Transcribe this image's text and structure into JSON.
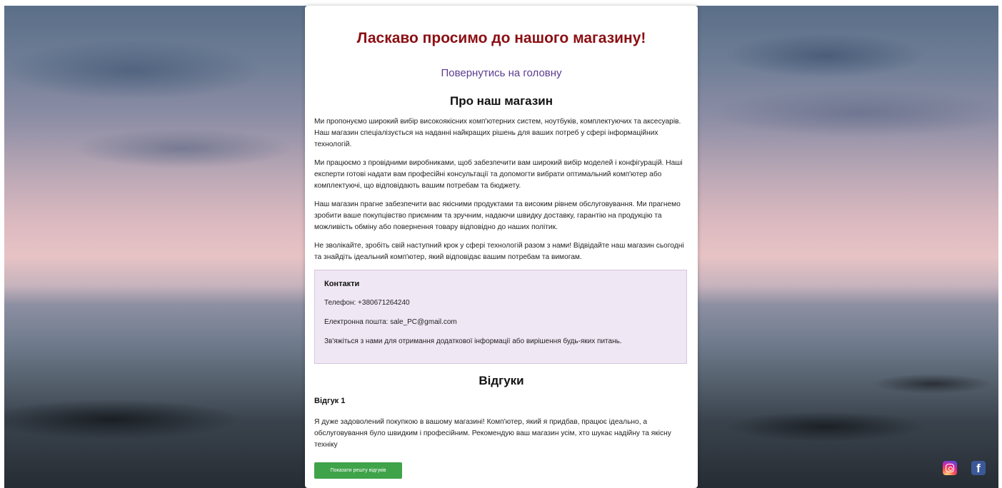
{
  "header": {
    "title": "Ласкаво просимо до нашого магазину!",
    "home_link": "Повернутись на головну"
  },
  "about": {
    "title": "Про наш магазин",
    "paragraphs": [
      "Ми пропонуємо широкий вибір високоякісних комп'ютерних систем, ноутбуків, комплектуючих та аксесуарів. Наш магазин спеціалізується на наданні найкращих рішень для ваших потреб у сфері інформаційних технологій.",
      "Ми працюємо з провідними виробниками, щоб забезпечити вам широкий вибір моделей і конфігурацій. Наші експерти готові надати вам професійні консультації та допомогти вибрати оптимальний комп'ютер або комплектуючі, що відповідають вашим потребам та бюджету.",
      "Наш магазин прагне забезпечити вас якісними продуктами та високим рівнем обслуговування. Ми прагнемо зробити ваше покупцівство приємним та зручним, надаючи швидку доставку, гарантію на продукцію та можливість обміну або повернення товару відповідно до наших політик.",
      "Не зволікайте, зробіть свій наступний крок у сфері технологій разом з нами! Відвідайте наш магазин сьогодні та знайдіть ідеальний комп'ютер, який відповідає вашим потребам та вимогам."
    ]
  },
  "contacts": {
    "title": "Контакти",
    "phone": "Телефон: +380671264240",
    "email": "Електронна пошта: sale_PC@gmail.com",
    "note": "Зв'яжіться з нами для отримання додаткової інформації або вирішення будь-яких питань."
  },
  "reviews": {
    "title": "Відгуки",
    "items": [
      {
        "heading": "Відгук 1",
        "text": "Я дуже задоволений покупкою в вашому магазині! Комп'ютер, який я придбав, працює ідеально, а обслуговування було швидким і професійним. Рекомендую ваш магазин усім, хто шукає надійну та якісну техніку"
      }
    ],
    "show_more_label": "Показати решту відгуків"
  },
  "social": {
    "icons": [
      "instagram-icon",
      "facebook-icon"
    ],
    "facebook_glyph": "f"
  },
  "colors": {
    "title": "#8b0e13",
    "link": "#5b3b8f",
    "contacts_bg": "#efe7f4",
    "button": "#3fa34a"
  }
}
